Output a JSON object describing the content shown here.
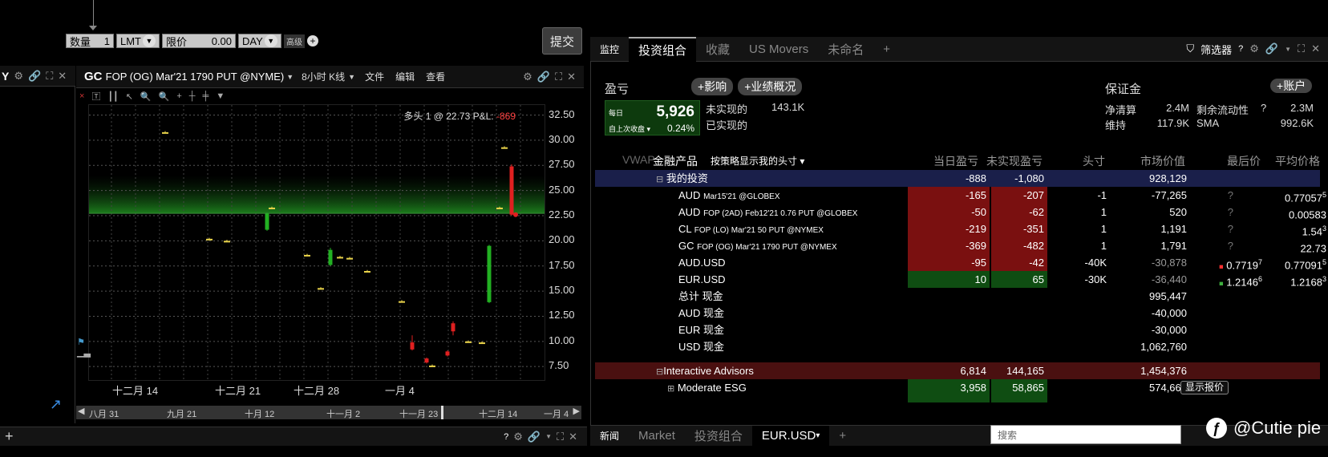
{
  "order_bar": {
    "qty_label": "数量",
    "qty_value": "1",
    "order_type": "LMT",
    "limit_label": "限价",
    "limit_value": "0.00",
    "tif": "DAY",
    "advanced": "高级",
    "submit": "提交"
  },
  "left_panel": {
    "title_fragment": "Y"
  },
  "chart": {
    "title_main": "GC",
    "title_rest": "FOP (OG) Mar'21 1790 PUT @NYME)",
    "interval": "8小时 K线",
    "menu": [
      "文件",
      "编辑",
      "查看"
    ],
    "pnl_label": "多头 1 @ 22.73 P&L:",
    "pnl_value": "-869"
  },
  "chart_data": {
    "type": "candlestick",
    "y_ticks": [
      "32.50",
      "30.00",
      "27.50",
      "25.00",
      "22.50",
      "20.00",
      "17.50",
      "15.00",
      "12.50",
      "10.00",
      "7.50"
    ],
    "ylim": [
      6.0,
      33.5
    ],
    "x_ticks": [
      "十二月 14",
      "十二月 21",
      "十二月 28",
      "一月 4"
    ],
    "nav_ticks": [
      "八月 31",
      "九月 21",
      "十月 12",
      "十一月 2",
      "十一月 23",
      "十二月 14",
      "一月 4"
    ],
    "entry_price": 22.73,
    "bars": [
      {
        "o": 30.8,
        "c": 30.8,
        "h": 30.9,
        "l": 30.7,
        "color": "yellow"
      },
      {
        "o": 20.2,
        "c": 20.2,
        "h": 20.3,
        "l": 20.1,
        "color": "yellow"
      },
      {
        "o": 20.0,
        "c": 20.0,
        "h": 20.1,
        "l": 19.9,
        "color": "yellow"
      },
      {
        "o": 22.7,
        "c": 21.1,
        "h": 22.8,
        "l": 21.0,
        "color": "green"
      },
      {
        "o": 23.3,
        "c": 23.3,
        "h": 23.4,
        "l": 23.2,
        "color": "yellow"
      },
      {
        "o": 18.6,
        "c": 18.6,
        "h": 18.7,
        "l": 18.5,
        "color": "yellow"
      },
      {
        "o": 15.3,
        "c": 15.3,
        "h": 15.4,
        "l": 15.2,
        "color": "yellow"
      },
      {
        "o": 19.1,
        "c": 17.6,
        "h": 19.3,
        "l": 17.5,
        "color": "green"
      },
      {
        "o": 18.4,
        "c": 18.4,
        "h": 18.5,
        "l": 18.3,
        "color": "yellow"
      },
      {
        "o": 18.3,
        "c": 18.3,
        "h": 18.4,
        "l": 18.2,
        "color": "yellow"
      },
      {
        "o": 17.0,
        "c": 17.0,
        "h": 17.1,
        "l": 16.9,
        "color": "yellow"
      },
      {
        "o": 14.0,
        "c": 14.0,
        "h": 14.1,
        "l": 13.9,
        "color": "yellow"
      },
      {
        "o": 9.2,
        "c": 9.9,
        "h": 10.6,
        "l": 9.1,
        "color": "red"
      },
      {
        "o": 7.9,
        "c": 8.3,
        "h": 8.4,
        "l": 7.8,
        "color": "red"
      },
      {
        "o": 7.6,
        "c": 7.6,
        "h": 7.7,
        "l": 7.5,
        "color": "yellow"
      },
      {
        "o": 8.6,
        "c": 9.0,
        "h": 9.1,
        "l": 8.5,
        "color": "red"
      },
      {
        "o": 11.0,
        "c": 11.8,
        "h": 12.0,
        "l": 10.6,
        "color": "red"
      },
      {
        "o": 10.0,
        "c": 10.0,
        "h": 10.1,
        "l": 9.9,
        "color": "yellow"
      },
      {
        "o": 9.9,
        "c": 9.9,
        "h": 10.0,
        "l": 9.8,
        "color": "yellow"
      },
      {
        "o": 19.5,
        "c": 13.9,
        "h": 19.6,
        "l": 13.8,
        "color": "green"
      },
      {
        "o": 23.3,
        "c": 23.3,
        "h": 23.4,
        "l": 23.2,
        "color": "yellow"
      },
      {
        "o": 29.3,
        "c": 29.3,
        "h": 29.4,
        "l": 29.2,
        "color": "yellow"
      },
      {
        "o": 22.6,
        "c": 27.4,
        "h": 27.6,
        "l": 22.5,
        "color": "red"
      }
    ]
  },
  "tabs": [
    {
      "label": "监控",
      "state": "small"
    },
    {
      "label": "投资组合",
      "state": "active"
    },
    {
      "label": "收藏",
      "state": ""
    },
    {
      "label": "US Movers",
      "state": ""
    },
    {
      "label": "未命名",
      "state": ""
    },
    {
      "label": "+",
      "state": ""
    }
  ],
  "filter_label": "筛选器",
  "summary": {
    "pnl_title": "盈亏",
    "impact_btn": "影响",
    "perf_btn": "业绩概况",
    "daily_label": "每日",
    "daily_value": "5,926",
    "since_close": "自上次收盘",
    "daily_pct": "0.24%",
    "unrealized_label": "未实现的",
    "unrealized_value": "143.1K",
    "realized_label": "已实现的",
    "margin_title": "保证金",
    "account_btn": "账户",
    "net_liq_label": "净清算",
    "net_liq_value": "2.4M",
    "excess_liq_label": "剩余流动性",
    "excess_liq_value": "2.3M",
    "maint_label": "维持",
    "maint_value": "117.9K",
    "sma_label": "SMA",
    "sma_value": "992.6K",
    "q": "?"
  },
  "table": {
    "vwap": "VWAP",
    "headers": {
      "instrument": "金融产品",
      "by_strategy": "按策略显示我的头寸",
      "daily_pnl": "当日盈亏",
      "unrealized": "未实现盈亏",
      "position": "头寸",
      "market_value": "市场价值",
      "last": "最后价",
      "avg": "平均价格"
    },
    "group": {
      "name": "我的投资",
      "daily": "-888",
      "unreal": "-1,080",
      "mv": "928,129"
    },
    "rows": [
      {
        "sym": "AUD",
        "desc": "Mar15'21 @GLOBEX",
        "daily": "-165",
        "unreal": "-207",
        "pos": "-1",
        "mv": "-77,265",
        "last": "?",
        "avg": "0.77057",
        "avg_sup": "5",
        "dcol": "red",
        "ucol": "red"
      },
      {
        "sym": "AUD",
        "desc": "FOP (2AD) Feb12'21 0.76 PUT @GLOBEX",
        "daily": "-50",
        "unreal": "-62",
        "pos": "1",
        "mv": "520",
        "last": "?",
        "avg": "0.00583",
        "avg_sup": "",
        "dcol": "red",
        "ucol": "red"
      },
      {
        "sym": "CL",
        "desc": "FOP (LO) Mar'21 50 PUT @NYMEX",
        "daily": "-219",
        "unreal": "-351",
        "pos": "1",
        "mv": "1,191",
        "last": "?",
        "avg": "1.54",
        "avg_sup": "3",
        "dcol": "red",
        "ucol": "red"
      },
      {
        "sym": "GC",
        "desc": "FOP (OG) Mar'21 1790 PUT @NYMEX",
        "daily": "-369",
        "unreal": "-482",
        "pos": "1",
        "mv": "1,791",
        "last": "?",
        "avg": "22.73",
        "avg_sup": "",
        "dcol": "red",
        "ucol": "red"
      },
      {
        "sym": "AUD.USD",
        "desc": "",
        "daily": "-95",
        "unreal": "-42",
        "pos": "-40K",
        "mv": "-30,878",
        "last": "0.7719",
        "last_sup": "7",
        "avg": "0.77091",
        "avg_sup": "5",
        "dcol": "red",
        "ucol": "red",
        "dot": "red"
      },
      {
        "sym": "EUR.USD",
        "desc": "",
        "daily": "10",
        "unreal": "65",
        "pos": "-30K",
        "mv": "-36,440",
        "last": "1.2146",
        "last_sup": "6",
        "avg": "1.2168",
        "avg_sup": "3",
        "dcol": "green",
        "ucol": "green",
        "dot": "green"
      }
    ],
    "cash_rows": [
      {
        "name": "总计 现金",
        "mv": "995,447"
      },
      {
        "name": "AUD 现金",
        "mv": "-40,000"
      },
      {
        "name": "EUR 现金",
        "mv": "-30,000"
      },
      {
        "name": "USD 现金",
        "mv": "1,062,760"
      }
    ],
    "advisors": {
      "name": "Interactive Advisors",
      "daily": "6,814",
      "unreal": "144,165",
      "mv": "1,454,376"
    },
    "esg": {
      "name": "Moderate ESG",
      "daily": "3,958",
      "unreal": "58,865",
      "mv": "574,663",
      "btn": "显示报价"
    }
  },
  "bottom_tabs": [
    {
      "label": "新闻",
      "state": "small"
    },
    {
      "label": "Market",
      "state": ""
    },
    {
      "label": "投资组合",
      "state": ""
    },
    {
      "label": "EUR.USD",
      "state": "active"
    },
    {
      "label": "+",
      "state": ""
    }
  ],
  "search_placeholder": "搜索",
  "watermark": "@Cutie pie"
}
